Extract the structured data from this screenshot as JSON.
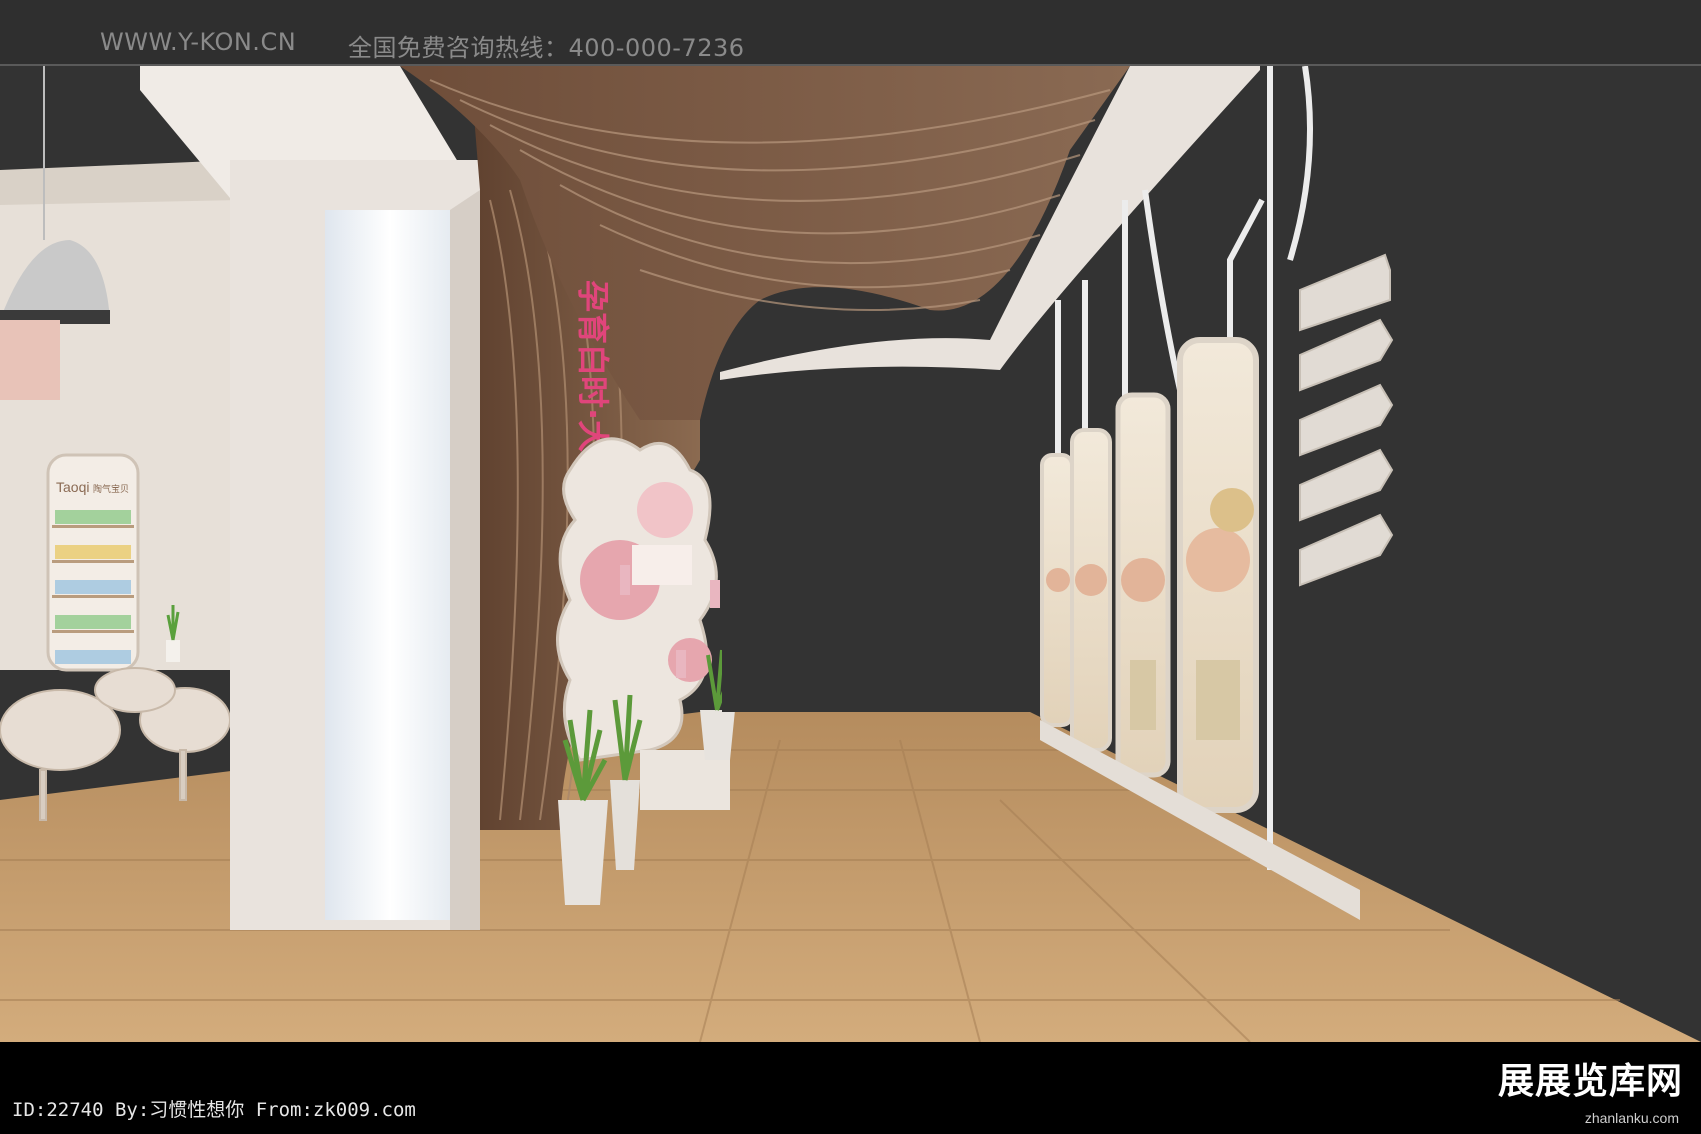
{
  "header": {
    "site": "WWW.Y-KON.CN",
    "hotline": "全国免费咨询热线：400-000-7236"
  },
  "scene": {
    "slogan": "孕育白时·大方之道",
    "store_brand": "Taoqi",
    "store_brand_cn": "陶气宝贝",
    "colors": {
      "backdrop": "#333333",
      "wood_ceiling": "#7a5a44",
      "wall_white": "#ece6df",
      "floor": "#c19a6b",
      "accent_pink": "#e0457b",
      "poster_bg": "#efe4d2"
    }
  },
  "footer": {
    "credit": "ID:22740 By:习惯性想你 From:zk009.com",
    "watermark": "展展览库网",
    "watermark_url": "zhanlanku.com"
  }
}
